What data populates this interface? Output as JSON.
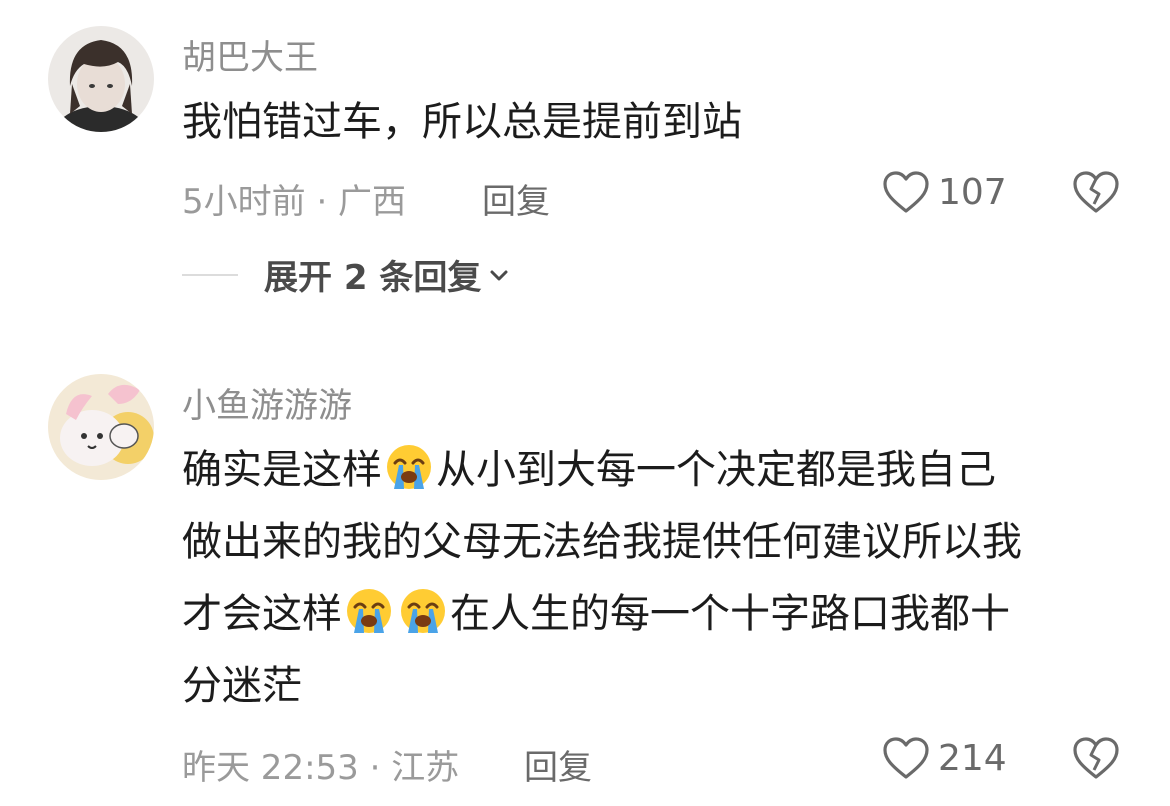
{
  "comments": [
    {
      "username": "胡巴大王",
      "text_lines": [
        "我怕错过车，所以总是提前到站"
      ],
      "time_location": "5小时前 · 广西",
      "reply_label": "回复",
      "likes": "107",
      "expand_label": "展开 2 条回复"
    },
    {
      "username": "小鱼游游游",
      "text_lines": [
        [
          "确实是这样",
          "😭",
          "从小到大每一个决定都是我自己"
        ],
        [
          "做出来的我的父母无法给我提供任何建议所以我"
        ],
        [
          "才会这样",
          "😭",
          "😭",
          "在人生的每一个十字路口我都十"
        ],
        [
          "分迷茫"
        ]
      ],
      "line_1_a": "确实是这样",
      "line_1_b": "从小到大每一个决定都是我自己",
      "line_2": "做出来的我的父母无法给我提供任何建议所以我",
      "line_3_a": "才会这样",
      "line_3_b": "在人生的每一个十字路口我都十",
      "line_4": "分迷茫",
      "time_location": "昨天 22:53 · 江苏",
      "reply_label": "回复",
      "likes": "214"
    }
  ],
  "icons": [
    "heart-outline-icon",
    "broken-heart-icon",
    "chevron-down-icon",
    "loudly-crying-face-emoji"
  ],
  "colors": {
    "text_primary": "#1c1c1c",
    "text_secondary": "#8e8e8e",
    "divider": "#dcdcdc"
  }
}
